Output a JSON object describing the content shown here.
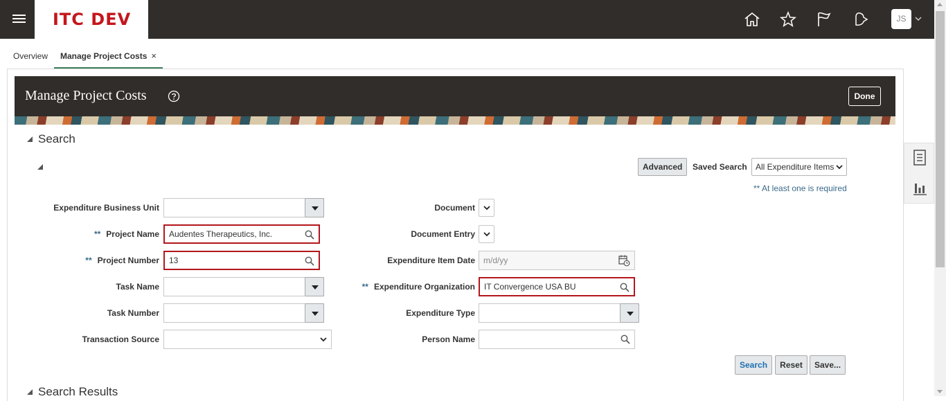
{
  "app": {
    "logo": "ITC DEV",
    "user_initials": "JS"
  },
  "tabs": [
    {
      "label": "Overview"
    },
    {
      "label": "Manage Project Costs",
      "close": "×"
    }
  ],
  "header": {
    "title": "Manage Project Costs",
    "done_label": "Done"
  },
  "search": {
    "section_title": "Search",
    "advanced_label": "Advanced",
    "saved_search_label": "Saved Search",
    "saved_search_value": "All Expenditure Items",
    "required_note": "** At least one is required",
    "required_marker": "**",
    "fields": {
      "expenditure_business_unit": {
        "label": "Expenditure Business Unit",
        "value": ""
      },
      "project_name": {
        "label": "Project Name",
        "value": "Audentes Therapeutics, Inc."
      },
      "project_number": {
        "label": "Project Number",
        "value": "13"
      },
      "task_name": {
        "label": "Task Name",
        "value": ""
      },
      "task_number": {
        "label": "Task Number",
        "value": ""
      },
      "transaction_source": {
        "label": "Transaction Source",
        "value": ""
      },
      "document": {
        "label": "Document"
      },
      "document_entry": {
        "label": "Document Entry"
      },
      "expenditure_item_date": {
        "label": "Expenditure Item Date",
        "placeholder": "m/d/yy"
      },
      "expenditure_organization": {
        "label": "Expenditure Organization",
        "value": "IT Convergence USA BU"
      },
      "expenditure_type": {
        "label": "Expenditure Type",
        "value": ""
      },
      "person_name": {
        "label": "Person Name",
        "value": ""
      }
    },
    "buttons": {
      "search": "Search",
      "reset": "Reset",
      "save": "Save..."
    }
  },
  "results": {
    "section_title": "Search Results"
  },
  "icons": [
    "menu-icon",
    "home-icon",
    "star-icon",
    "flag-icon",
    "bell-icon",
    "help-icon",
    "search-icon",
    "calendar-icon",
    "document-icon",
    "chart-icon"
  ]
}
